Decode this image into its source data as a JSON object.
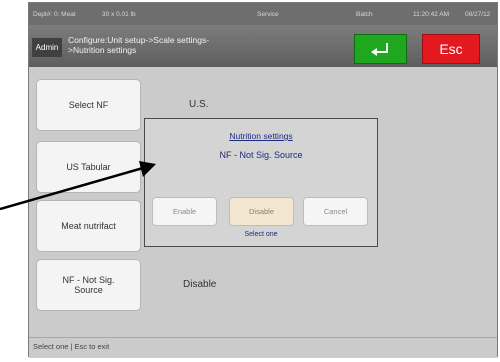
{
  "statusbar": {
    "dept": "Dept#: 0: Meat",
    "capacity": "30 x 0.01 lb",
    "mode": "Service",
    "batch": "Batch",
    "time": "11:20:42 AM",
    "date": "08/27/12"
  },
  "header": {
    "user_badge": "Admin",
    "breadcrumb_line1": "Configure:Unit setup->Scale settings-",
    "breadcrumb_line2": ">Nutrition settings",
    "esc_label": "Esc"
  },
  "settings": [
    {
      "label": "Select NF",
      "value": "U.S."
    },
    {
      "label": "US Tabular",
      "value": ""
    },
    {
      "label": "Meat nutrifact",
      "value": ""
    },
    {
      "label": "NF - Not Sig. Source",
      "value": "Disable"
    }
  ],
  "dialog": {
    "title": "Nutrition settings",
    "message": "NF - Not Sig. Source",
    "enable_label": "Enable",
    "disable_label": "Disable",
    "cancel_label": "Cancel",
    "hint": "Select one"
  },
  "footer": {
    "hint": "Select one | Esc to exit"
  },
  "colors": {
    "enter_button": "#1fa81f",
    "esc_button": "#e2191f",
    "dialog_text": "#1c2b80",
    "selected_option": "#f3e7d1"
  },
  "icons": {
    "enter": "return-arrow-icon",
    "annotation": "pointer-arrow"
  }
}
